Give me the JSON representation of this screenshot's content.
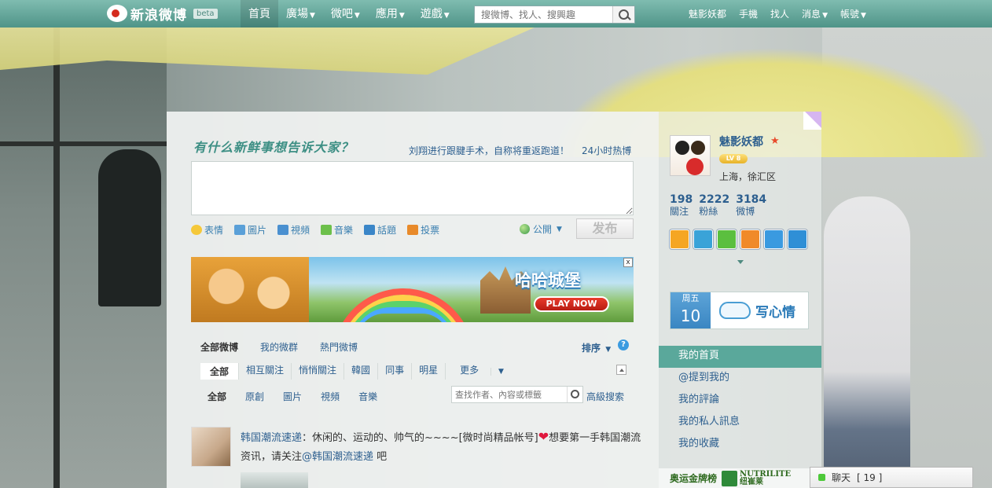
{
  "topbar": {
    "logo_text": "新浪微博",
    "beta": "beta",
    "nav": [
      {
        "label": "首頁",
        "dropdown": false
      },
      {
        "label": "廣場",
        "dropdown": true
      },
      {
        "label": "微吧",
        "dropdown": true
      },
      {
        "label": "應用",
        "dropdown": true
      },
      {
        "label": "遊戲",
        "dropdown": true
      }
    ],
    "search_placeholder": "搜微博、找人、搜興趣",
    "right_nav": [
      {
        "label": "魅影妖都",
        "dropdown": false
      },
      {
        "label": "手機",
        "dropdown": false
      },
      {
        "label": "找人",
        "dropdown": false
      },
      {
        "label": "消息",
        "dropdown": true
      },
      {
        "label": "帳號",
        "dropdown": true
      }
    ]
  },
  "composer": {
    "prompt": "有什么新鲜事想告诉大家？",
    "hot_topic": "刘翔进行跟腱手术，自称将重返跑道！",
    "hot_link": "24小时热博",
    "tools": [
      {
        "label": "表情",
        "icon": "smiley-icon",
        "color": "#f5c83a"
      },
      {
        "label": "圖片",
        "icon": "image-icon",
        "color": "#5aa0d8"
      },
      {
        "label": "視頻",
        "icon": "video-icon",
        "color": "#4a90d0"
      },
      {
        "label": "音樂",
        "icon": "music-icon",
        "color": "#6cc04a"
      },
      {
        "label": "話題",
        "icon": "topic-icon",
        "color": "#3a86c8"
      },
      {
        "label": "投票",
        "icon": "poll-icon",
        "color": "#e88a2a"
      }
    ],
    "visibility": "公開",
    "post_label": "发布"
  },
  "banner": {
    "title": "哈哈城堡",
    "play": "PLAY NOW",
    "close": "x"
  },
  "feed_tabs": {
    "primary": [
      "全部微博",
      "我的微群",
      "熱門微博"
    ],
    "sort": "排序",
    "groups": [
      "全部",
      "相互關注",
      "悄悄關注",
      "韓國",
      "同事",
      "明星",
      "更多"
    ],
    "types": [
      "全部",
      "原創",
      "圖片",
      "視頻",
      "音樂"
    ],
    "filter_placeholder": "查找作者、內容或標籤",
    "advanced_search": "高級搜索"
  },
  "feed": [
    {
      "author": "韩国潮流速递",
      "text_before": "：休闲的、运动的、帅气的~~~~[微时尚精品帐号]",
      "text_after": "想要第一手韩国潮流资讯，请关注",
      "mention": "@韩国潮流速递",
      "tail": " 吧"
    }
  ],
  "profile": {
    "name": "魅影妖都",
    "level": "LV 8",
    "location": "上海，徐汇区",
    "stats": [
      {
        "value": "198",
        "label": "關注"
      },
      {
        "value": "2222",
        "label": "粉絲"
      },
      {
        "value": "3184",
        "label": "微博"
      }
    ],
    "apps": [
      {
        "icon": "star-app-icon",
        "color": "#f5a623"
      },
      {
        "icon": "wave-app-icon",
        "color": "#3aa3d8"
      },
      {
        "icon": "chat-app-icon",
        "color": "#5bbf3f"
      },
      {
        "icon": "gift-app-icon",
        "color": "#f08a2a"
      },
      {
        "icon": "photo-app-icon",
        "color": "#3a9ae0"
      },
      {
        "icon": "people-app-icon",
        "color": "#2f8fd6"
      }
    ]
  },
  "mood": {
    "weekday": "周五",
    "day": "10",
    "label": "写心情"
  },
  "side_menu": [
    "我的首頁",
    "@提到我的",
    "我的評論",
    "我的私人訊息",
    "我的收藏"
  ],
  "sponsor": {
    "label": "奥运金牌榜",
    "brand_en": "NUTRILITE",
    "brand_cn": "纽崔莱"
  },
  "chat": {
    "label": "聊天",
    "count": "[ 19 ]"
  }
}
